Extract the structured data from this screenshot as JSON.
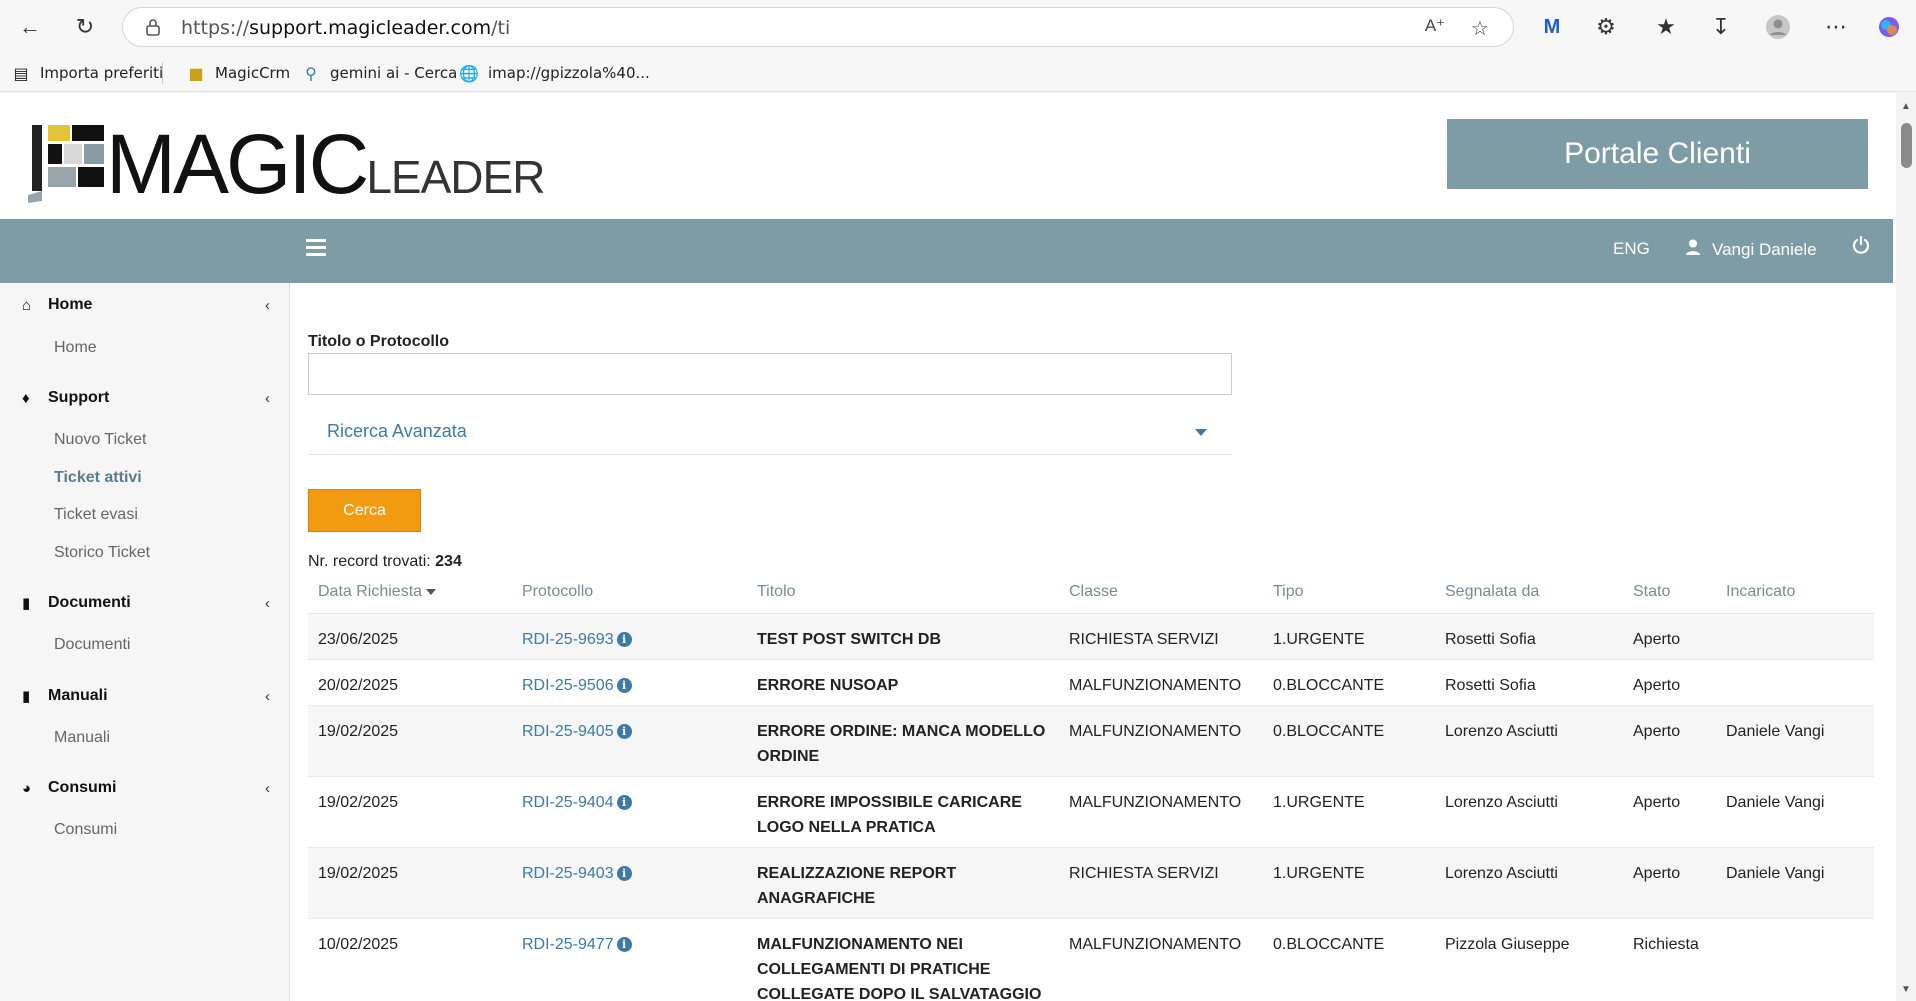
{
  "browser": {
    "url_prefix": "https://",
    "url_domain": "support.magicleader.com",
    "url_path": "/ti",
    "bookmarks": [
      {
        "label": "Importa preferiti",
        "icon": "import-icon"
      },
      {
        "label": "MagicCrm",
        "icon": "magiccrm-favicon"
      },
      {
        "label": "gemini ai - Cerca",
        "icon": "search-icon"
      },
      {
        "label": "imap://gpizzola%40...",
        "icon": "globe-icon"
      }
    ]
  },
  "header": {
    "logo_main": "MAGIC",
    "logo_sub": "LEADER",
    "portal_label": "Portale Clienti"
  },
  "topbar": {
    "lang": "ENG",
    "user": "Vangi Daniele"
  },
  "sidebar": {
    "sections": [
      {
        "label": "Home",
        "icon": "home-icon",
        "items": [
          "Home"
        ]
      },
      {
        "label": "Support",
        "icon": "ticket-icon",
        "items": [
          "Nuovo Ticket",
          "Ticket attivi",
          "Ticket evasi",
          "Storico Ticket"
        ]
      },
      {
        "label": "Documenti",
        "icon": "book-icon",
        "items": [
          "Documenti"
        ]
      },
      {
        "label": "Manuali",
        "icon": "book-icon",
        "items": [
          "Manuali"
        ]
      },
      {
        "label": "Consumi",
        "icon": "dashboard-icon",
        "items": [
          "Consumi"
        ]
      }
    ],
    "active_item": "Ticket attivi"
  },
  "search": {
    "label": "Titolo o Protocollo",
    "value": "",
    "advanced_label": "Ricerca Avanzata",
    "button_label": "Cerca"
  },
  "results": {
    "count_label": "Nr. record trovati:",
    "count": "234",
    "columns": [
      "Data Richiesta",
      "Protocollo",
      "Titolo",
      "Classe",
      "Tipo",
      "Segnalata da",
      "Stato",
      "Incaricato"
    ],
    "rows": [
      {
        "data": "23/06/2025",
        "protocollo": "RDI-25-9693",
        "titolo": "TEST POST SWITCH DB",
        "classe": "RICHIESTA SERVIZI",
        "tipo": "1.URGENTE",
        "segnalata": "Rosetti Sofia",
        "stato": "Aperto",
        "incaricato": ""
      },
      {
        "data": "20/02/2025",
        "protocollo": "RDI-25-9506",
        "titolo": "ERRORE NUSOAP",
        "classe": "MALFUNZIONAMENTO",
        "tipo": "0.BLOCCANTE",
        "segnalata": "Rosetti Sofia",
        "stato": "Aperto",
        "incaricato": ""
      },
      {
        "data": "19/02/2025",
        "protocollo": "RDI-25-9405",
        "titolo": "ERRORE ORDINE: MANCA MODELLO ORDINE",
        "classe": "MALFUNZIONAMENTO",
        "tipo": "0.BLOCCANTE",
        "segnalata": "Lorenzo Asciutti",
        "stato": "Aperto",
        "incaricato": "Daniele Vangi"
      },
      {
        "data": "19/02/2025",
        "protocollo": "RDI-25-9404",
        "titolo": "ERRORE IMPOSSIBILE CARICARE LOGO NELLA PRATICA",
        "classe": "MALFUNZIONAMENTO",
        "tipo": "1.URGENTE",
        "segnalata": "Lorenzo Asciutti",
        "stato": "Aperto",
        "incaricato": "Daniele Vangi"
      },
      {
        "data": "19/02/2025",
        "protocollo": "RDI-25-9403",
        "titolo": "REALIZZAZIONE REPORT ANAGRAFICHE",
        "classe": "RICHIESTA SERVIZI",
        "tipo": "1.URGENTE",
        "segnalata": "Lorenzo Asciutti",
        "stato": "Aperto",
        "incaricato": "Daniele Vangi"
      },
      {
        "data": "10/02/2025",
        "protocollo": "RDI-25-9477",
        "titolo": "MALFUNZIONAMENTO NEI COLLEGAMENTI DI PRATICHE COLLEGATE DOPO IL SALVATAGGIO E",
        "classe": "MALFUNZIONAMENTO",
        "tipo": "0.BLOCCANTE",
        "segnalata": "Pizzola Giuseppe",
        "stato": "Richiesta",
        "incaricato": ""
      }
    ]
  },
  "colors": {
    "accent": "#7e9ca6",
    "button": "#f29b10",
    "link": "#3d7aa8"
  }
}
